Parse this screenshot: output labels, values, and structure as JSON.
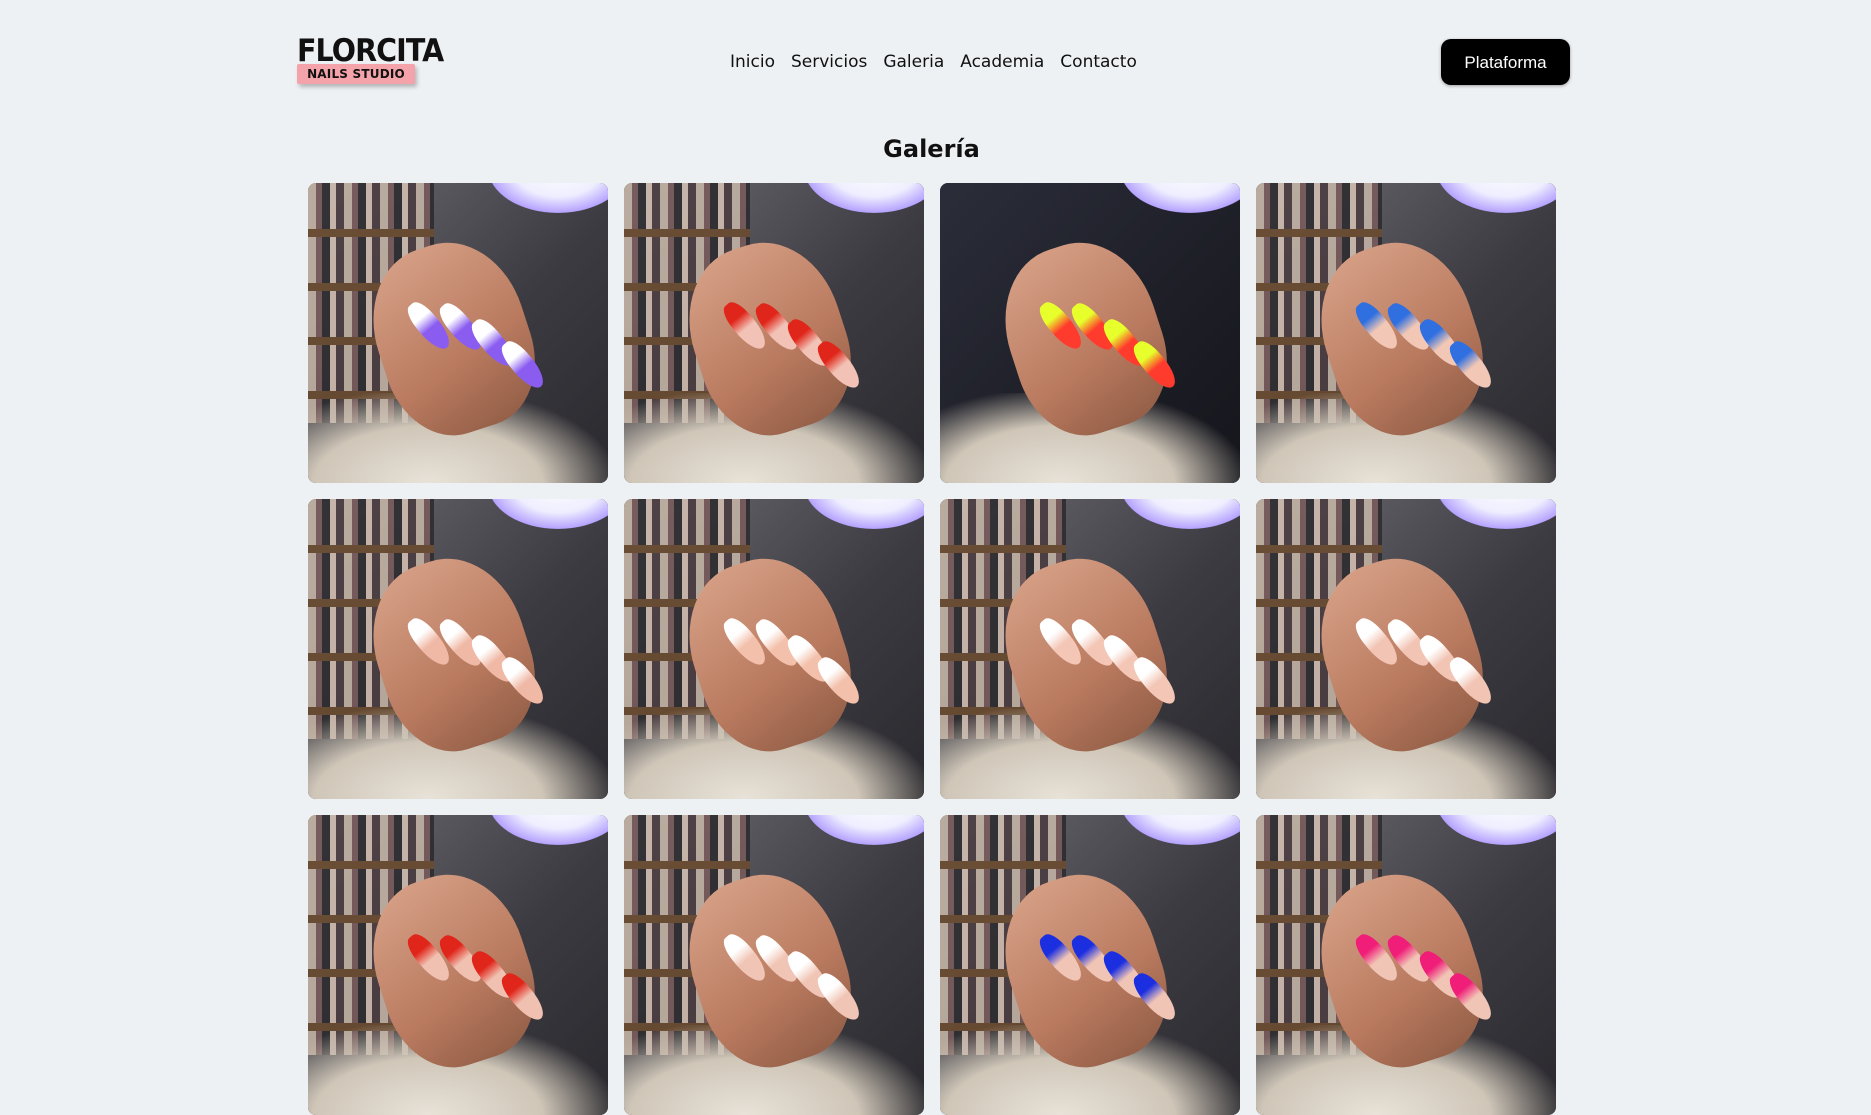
{
  "brand": {
    "logo_title": "FLORCITA",
    "logo_subtitle": "NAILS STUDIO",
    "accent_color": "#f3a3a9"
  },
  "nav": {
    "items": [
      {
        "label": "Inicio"
      },
      {
        "label": "Servicios"
      },
      {
        "label": "Galeria"
      },
      {
        "label": "Academia"
      },
      {
        "label": "Contacto"
      }
    ],
    "cta_label": "Plataforma"
  },
  "gallery": {
    "title": "Galería",
    "photos": [
      {
        "nail_color": "#8a5cf0",
        "tip_color": "#ffffff",
        "dark": false
      },
      {
        "nail_color": "#f1c2b5",
        "tip_color": "#e0261a",
        "dark": false
      },
      {
        "nail_color": "#ff3b2e",
        "tip_color": "#e7ff2b",
        "dark": true
      },
      {
        "nail_color": "#f2c7b5",
        "tip_color": "#2f6fe0",
        "dark": false
      },
      {
        "nail_color": "#f0b9a6",
        "tip_color": "#ffffff",
        "dark": false
      },
      {
        "nail_color": "#f3c0ab",
        "tip_color": "#ffffff",
        "dark": false
      },
      {
        "nail_color": "#f3c6b6",
        "tip_color": "#ffffff",
        "dark": false
      },
      {
        "nail_color": "#f2c4b4",
        "tip_color": "#ffffff",
        "dark": false
      },
      {
        "nail_color": "#f0c1b1",
        "tip_color": "#e0261a",
        "dark": false
      },
      {
        "nail_color": "#f1c5b5",
        "tip_color": "#ffffff",
        "dark": false
      },
      {
        "nail_color": "#f1c5b5",
        "tip_color": "#1c2fe0",
        "dark": false
      },
      {
        "nail_color": "#f1c5b5",
        "tip_color": "#f01e78",
        "dark": false
      }
    ]
  }
}
